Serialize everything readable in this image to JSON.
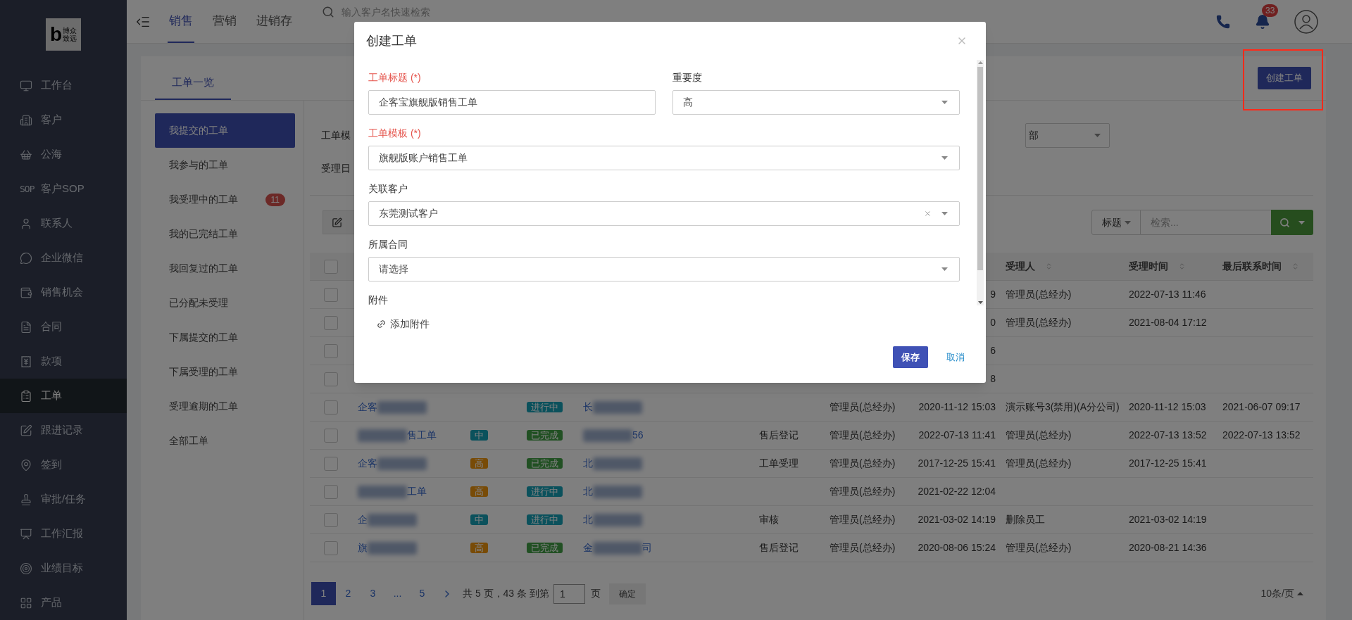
{
  "sidebar": {
    "logo": {
      "letter": "b",
      "text": [
        "博众",
        "致远"
      ]
    },
    "items": [
      {
        "label": "工作台",
        "selected": false
      },
      {
        "label": "客户",
        "selected": false
      },
      {
        "label": "公海",
        "selected": false
      },
      {
        "label": "客户SOP",
        "icon_text": "SOP",
        "selected": false
      },
      {
        "label": "联系人",
        "selected": false
      },
      {
        "label": "企业微信",
        "selected": false
      },
      {
        "label": "销售机会",
        "selected": false
      },
      {
        "label": "合同",
        "selected": false
      },
      {
        "label": "款项",
        "selected": false
      },
      {
        "label": "工单",
        "selected": true
      },
      {
        "label": "跟进记录",
        "selected": false
      },
      {
        "label": "签到",
        "selected": false
      },
      {
        "label": "审批/任务",
        "selected": false
      },
      {
        "label": "工作汇报",
        "selected": false
      },
      {
        "label": "业绩目标",
        "selected": false
      },
      {
        "label": "产品",
        "selected": false
      }
    ]
  },
  "top_bar": {
    "tabs": [
      {
        "label": "销售",
        "selected": true
      },
      {
        "label": "营销",
        "selected": false
      },
      {
        "label": "进销存",
        "selected": false
      }
    ],
    "search": {
      "placeholder": "输入客户名快速检索"
    },
    "notifications": {
      "count": "33"
    }
  },
  "page": {
    "tabs": [
      {
        "label": "工单一览",
        "selected": true
      }
    ],
    "create_button": "创建工单",
    "menu": [
      {
        "label": "我提交的工单",
        "selected": true
      },
      {
        "label": "我参与的工单",
        "selected": false
      },
      {
        "label": "我受理中的工单",
        "selected": false,
        "badge": "11"
      },
      {
        "label": "我的已完结工单",
        "selected": false
      },
      {
        "label": "我回复过的工单",
        "selected": false
      },
      {
        "label": "已分配未受理",
        "selected": false
      },
      {
        "label": "下属提交的工单",
        "selected": false
      },
      {
        "label": "下属受理的工单",
        "selected": false
      },
      {
        "label": "受理逾期的工单",
        "selected": false
      },
      {
        "label": "全部工单",
        "selected": false
      }
    ],
    "filters": {
      "labels": [
        "工单模",
        "受理日"
      ],
      "dropdown": "部"
    },
    "search": {
      "field": "标题",
      "placeholder": "检索..."
    },
    "table": {
      "header_checked": false,
      "columns": [
        {
          "label": "受理人",
          "sortable": true
        },
        {
          "label": "受理时间",
          "sortable": true
        },
        {
          "label": "最后联系时间",
          "sortable": true
        }
      ],
      "rows": [
        {
          "checked": false,
          "created": "9",
          "handler": "管理员(总经办)",
          "handled": "2022-07-13 11:46"
        },
        {
          "checked": false,
          "created": "0",
          "handler": "管理员(总经办)",
          "handled": "2021-08-04 17:12"
        },
        {
          "checked": false,
          "created": "6"
        },
        {
          "checked": false,
          "created": "8"
        },
        {
          "checked": false,
          "title": [
            {
              "kind": "text",
              "text": "企客"
            },
            {
              "kind": "blur"
            }
          ],
          "status": {
            "label": "进行中",
            "kind": "in_progress"
          },
          "customer": [
            {
              "kind": "text",
              "text": "长"
            },
            {
              "kind": "blur"
            }
          ],
          "creator": "管理员(总经办)",
          "created": "2020-11-12 15:03",
          "handler": "演示账号3(禁用)(A分公司)",
          "handled": "2020-11-12 15:03",
          "last_contact": "2021-06-07 09:17"
        },
        {
          "checked": false,
          "title": [
            {
              "kind": "blur"
            },
            {
              "kind": "text",
              "text": "售工单"
            }
          ],
          "priority": {
            "label": "中",
            "kind": "medium"
          },
          "status": {
            "label": "已完成",
            "kind": "done"
          },
          "customer": [
            {
              "kind": "blur"
            },
            {
              "kind": "text",
              "text": "56"
            }
          ],
          "stage": "售后登记",
          "creator": "管理员(总经办)",
          "created": "2022-07-13 11:41",
          "handler": "管理员(总经办)",
          "handled": "2022-07-13 13:52",
          "last_contact": "2022-07-13 13:52"
        },
        {
          "checked": false,
          "title": [
            {
              "kind": "text",
              "text": "企客"
            },
            {
              "kind": "blur"
            }
          ],
          "priority": {
            "label": "高",
            "kind": "high"
          },
          "status": {
            "label": "已完成",
            "kind": "done"
          },
          "customer": [
            {
              "kind": "text",
              "text": "北"
            },
            {
              "kind": "blur"
            }
          ],
          "stage": "工单受理",
          "creator": "管理员(总经办)",
          "created": "2017-12-25 15:41",
          "handler": "管理员(总经办)",
          "handled": "2017-12-25 15:41"
        },
        {
          "checked": false,
          "title": [
            {
              "kind": "blur"
            },
            {
              "kind": "text",
              "text": "工单"
            }
          ],
          "priority": {
            "label": "高",
            "kind": "high"
          },
          "status": {
            "label": "进行中",
            "kind": "in_progress"
          },
          "customer": [
            {
              "kind": "text",
              "text": "北"
            },
            {
              "kind": "blur"
            }
          ],
          "creator": "管理员(总经办)",
          "created": "2021-02-22 12:04"
        },
        {
          "checked": false,
          "title": [
            {
              "kind": "text",
              "text": "企"
            },
            {
              "kind": "blur"
            }
          ],
          "priority": {
            "label": "中",
            "kind": "medium"
          },
          "status": {
            "label": "进行中",
            "kind": "in_progress"
          },
          "customer": [
            {
              "kind": "text",
              "text": "北"
            },
            {
              "kind": "blur"
            }
          ],
          "stage": "审核",
          "creator": "管理员(总经办)",
          "created": "2021-03-02 14:19",
          "handler": "删除员工",
          "handled": "2021-03-02 14:19"
        },
        {
          "checked": false,
          "title": [
            {
              "kind": "text",
              "text": "旗"
            },
            {
              "kind": "blur"
            }
          ],
          "priority": {
            "label": "高",
            "kind": "high"
          },
          "status": {
            "label": "已完成",
            "kind": "done"
          },
          "customer": [
            {
              "kind": "text",
              "text": "金"
            },
            {
              "kind": "blur"
            },
            {
              "kind": "text",
              "text": "司"
            }
          ],
          "stage": "售后登记",
          "creator": "管理员(总经办)",
          "created": "2020-08-06 15:24",
          "handler": "管理员(总经办)",
          "handled": "2020-08-21 14:36"
        }
      ]
    },
    "pagination": {
      "pages": [
        {
          "label": "1",
          "selected": true
        },
        {
          "label": "2",
          "selected": false
        },
        {
          "label": "3",
          "selected": false
        },
        {
          "label": "...",
          "selected": false
        },
        {
          "label": "5",
          "selected": false
        }
      ],
      "info": "共 5 页，43 条 到第",
      "page_input": "1",
      "page_unit": "页",
      "confirm": "确定",
      "page_size": "10条/页"
    }
  },
  "dialog": {
    "title": "创建工单",
    "rows": [
      [
        {
          "label": "工单标题 (*)",
          "required": true,
          "kind": "input",
          "value": "企客宝旗舰版销售工单"
        },
        {
          "label": "重要度",
          "required": false,
          "kind": "select",
          "value": "高"
        }
      ],
      [
        {
          "label": "工单模板 (*)",
          "required": true,
          "kind": "select",
          "value": "旗舰版账户销售工单"
        }
      ],
      [
        {
          "label": "关联客户",
          "required": false,
          "kind": "select",
          "value": "东莞测试客户",
          "clearable": true
        }
      ],
      [
        {
          "label": "所属合同",
          "required": false,
          "kind": "select",
          "placeholder": "请选择"
        }
      ]
    ],
    "attachment": {
      "label": "附件",
      "link": "添加附件"
    },
    "save": "保存",
    "cancel": "取消"
  }
}
